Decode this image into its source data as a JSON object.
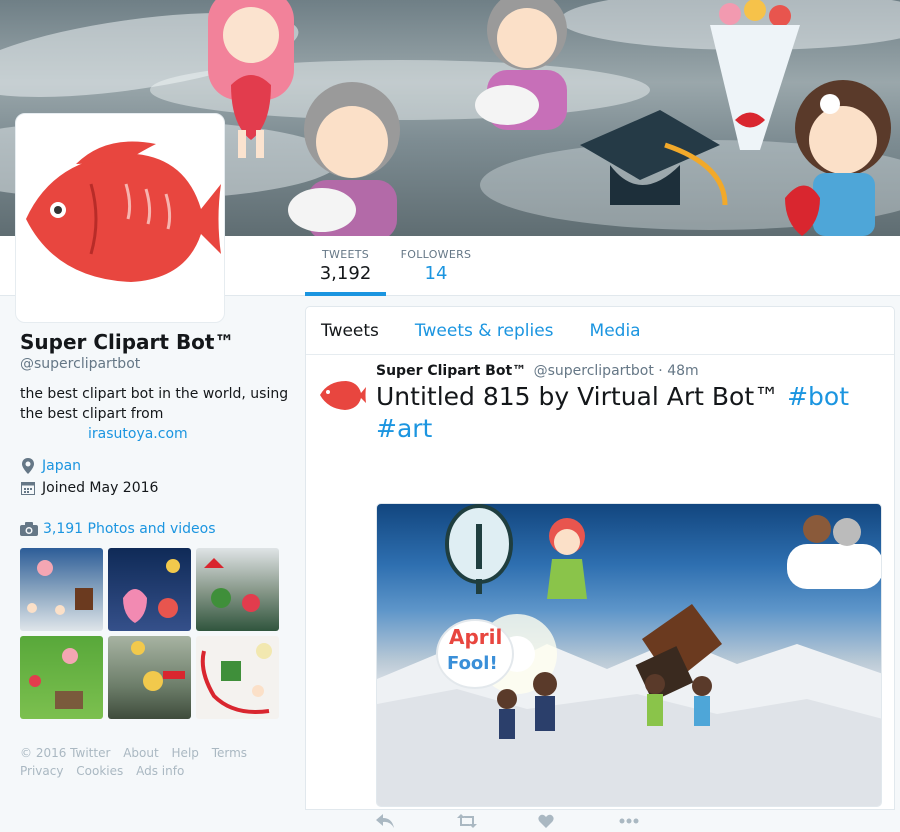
{
  "profile": {
    "name": "Super Clipart Bot™",
    "handle": "@superclipartbot",
    "bio": "the best clipart bot in the world, using the best clipart from",
    "bio_link": "irasutoya.com",
    "location": "Japan",
    "joined": "Joined May 2016",
    "photos_link": "3,191 Photos and videos"
  },
  "stats": {
    "tweets_label": "TWEETS",
    "tweets_value": "3,192",
    "followers_label": "FOLLOWERS",
    "followers_value": "14"
  },
  "timeline": {
    "tabs": [
      "Tweets",
      "Tweets & replies",
      "Media"
    ]
  },
  "tweet": {
    "author": "Super Clipart Bot™",
    "handle": "@superclipartbot",
    "separator": "·",
    "time": "48m",
    "text": "Untitled 815 by Virtual Art Bot™",
    "hashtags": [
      "#bot",
      "#art"
    ],
    "media_text": [
      "April",
      "Fool!"
    ]
  },
  "footer": {
    "links": [
      "© 2016 Twitter",
      "About",
      "Help",
      "Terms",
      "Privacy",
      "Cookies",
      "Ads info"
    ]
  },
  "colors": {
    "link": "#1b95e0",
    "muted": "#657786",
    "fish": "#e8463f"
  }
}
